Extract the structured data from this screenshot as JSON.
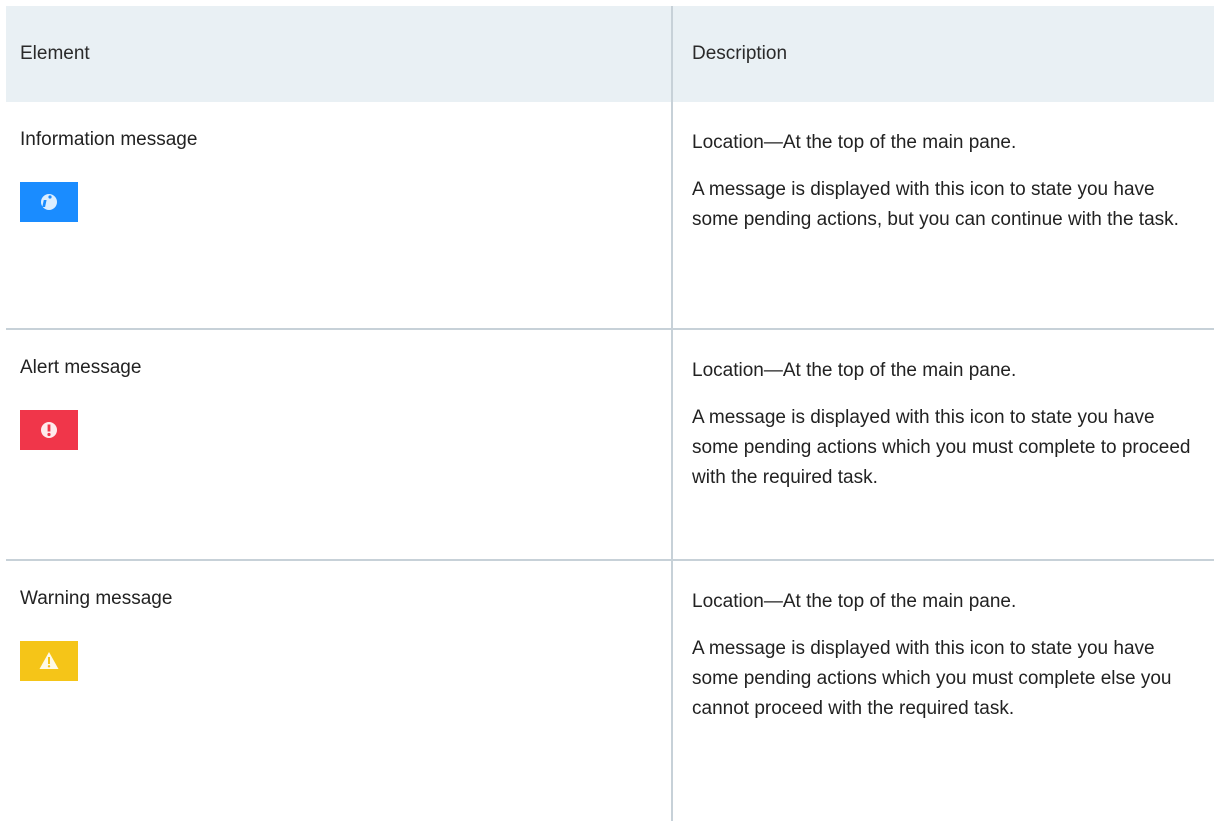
{
  "header": {
    "col_element": "Element",
    "col_description": "Description"
  },
  "rows": [
    {
      "element": "Information message",
      "icon": "info-icon",
      "icon_color": "#1a8cff",
      "location": "Location—At the top of the main pane.",
      "description": "A message is displayed with this icon to state you have some pending actions, but you can continue with the task."
    },
    {
      "element": "Alert message",
      "icon": "alert-icon",
      "icon_color": "#f0364a",
      "location": "Location—At the top of the main pane.",
      "description": "A message is displayed with this icon to state you have some pending actions which you must complete to proceed with the required task."
    },
    {
      "element": "Warning message",
      "icon": "warning-icon",
      "icon_color": "#f5c518",
      "location": "Location—At the top of the main pane.",
      "description": "A message is displayed with this icon to state you have some pending actions which you must complete else you cannot proceed with the required task."
    }
  ]
}
